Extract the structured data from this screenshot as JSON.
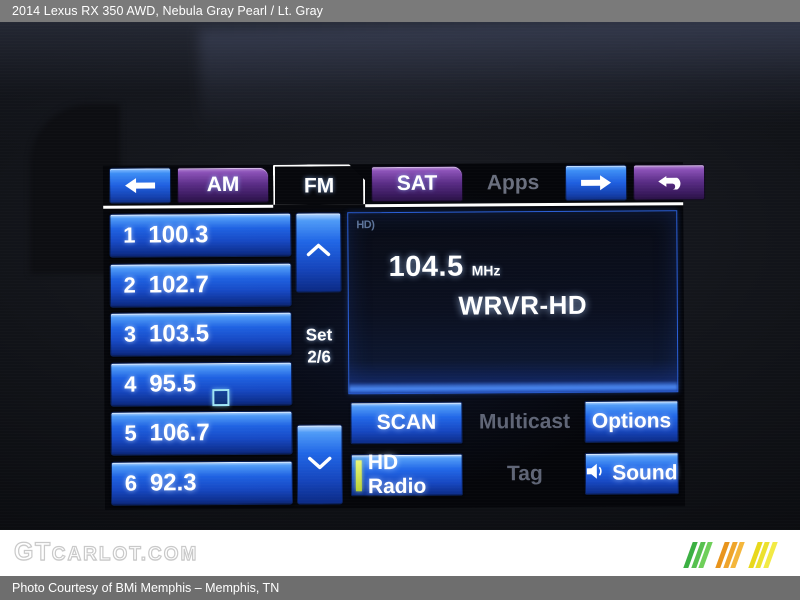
{
  "header": {
    "caption": "2014 Lexus RX 350 AWD,  Nebula Gray Pearl / Lt. Gray"
  },
  "radio": {
    "tabs": [
      {
        "label": "",
        "icon": "arrow-left-icon",
        "style": "blue",
        "active": false
      },
      {
        "label": "AM",
        "icon": "",
        "style": "purple",
        "active": false
      },
      {
        "label": "FM",
        "icon": "",
        "style": "active",
        "active": true
      },
      {
        "label": "SAT",
        "icon": "",
        "style": "purple",
        "active": false
      },
      {
        "label": "Apps",
        "icon": "",
        "style": "ghost",
        "active": false
      },
      {
        "label": "",
        "icon": "arrow-right-icon",
        "style": "blue",
        "active": false
      },
      {
        "label": "",
        "icon": "return-arrow-icon",
        "style": "purple",
        "active": false
      }
    ],
    "presets": [
      {
        "number": "1",
        "frequency": "100.3"
      },
      {
        "number": "2",
        "frequency": "102.7"
      },
      {
        "number": "3",
        "frequency": "103.5"
      },
      {
        "number": "4",
        "frequency": "95.5"
      },
      {
        "number": "5",
        "frequency": "106.7"
      },
      {
        "number": "6",
        "frequency": "92.3"
      }
    ],
    "set": {
      "label": "Set",
      "value": "2/6",
      "up_icon": "chevron-up-icon",
      "down_icon": "chevron-down-icon"
    },
    "display": {
      "hd_badge": "HD)",
      "frequency": "104.5",
      "unit": "MHz",
      "station": "WRVR-HD"
    },
    "controls": {
      "scan": "SCAN",
      "multicast": "Multicast",
      "options": "Options",
      "hd_radio": "HD Radio",
      "tag": "Tag",
      "sound": "Sound"
    },
    "colors": {
      "button_blue": "#2268e8",
      "tab_purple": "#5a2d86",
      "hd_indicator": "#d2ee4e",
      "display_border": "#2a5fd8"
    }
  },
  "watermark": {
    "brand_gt": "GT",
    "brand_rest": "CARLOT.COM",
    "logo_colors": [
      "#3cb043",
      "#e8941c",
      "#e8d81c"
    ]
  },
  "footer": {
    "caption": "Photo Courtesy of BMi Memphis – Memphis, TN"
  }
}
